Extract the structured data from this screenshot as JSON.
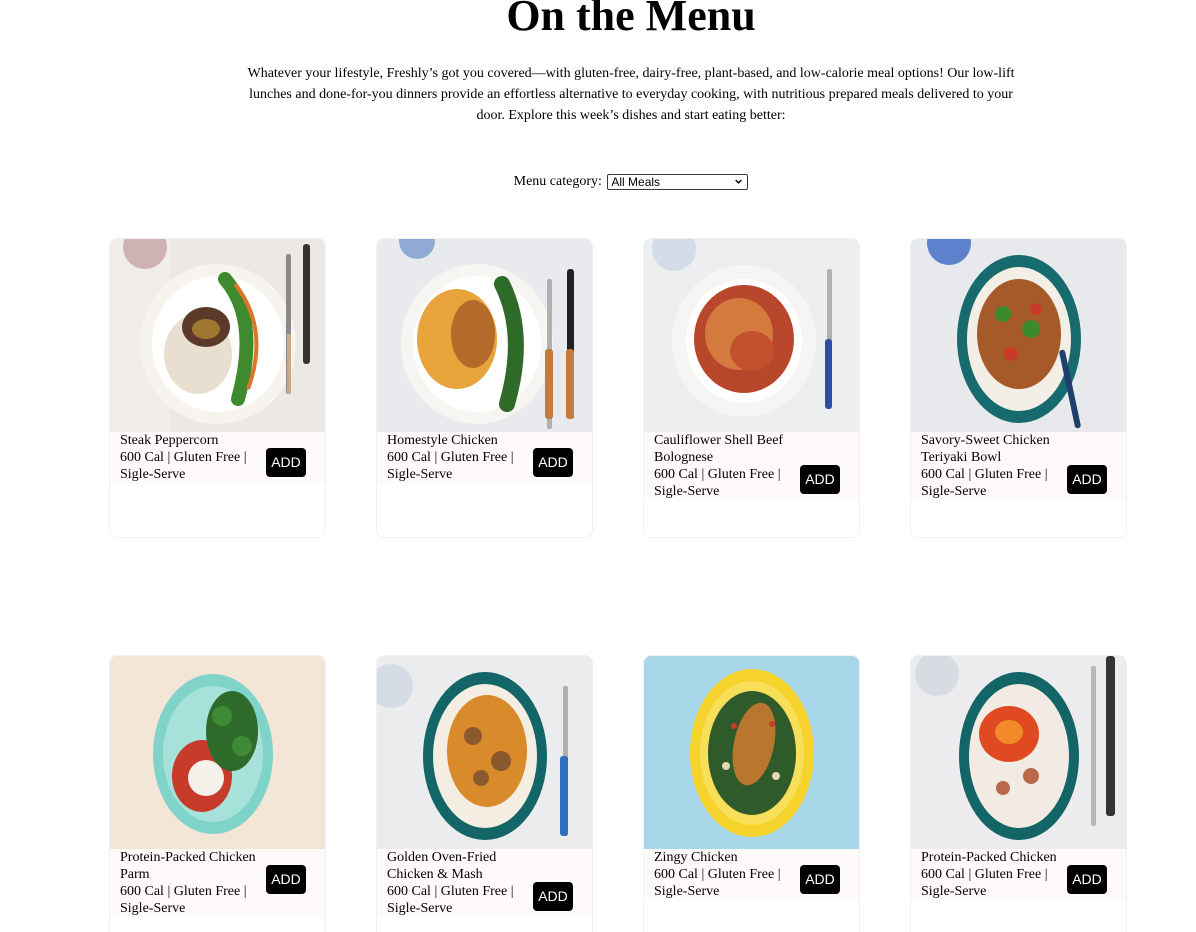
{
  "page": {
    "title": "On the Menu",
    "intro": "Whatever your lifestyle, Freshly’s got you covered—with gluten-free, dairy-free, plant-based, and low-calorie meal options! Our low-lift lunches and done-for-you dinners provide an effortless alternative to everyday cooking, with nutritious prepared meals delivered to your door. Explore this week’s dishes and start eating better:"
  },
  "filter": {
    "label": "Menu category:",
    "selected": "All Meals"
  },
  "meals": [
    {
      "name": "Steak Peppercorn",
      "details": "600 Cal | Gluten Free | Sigle-Serve",
      "add_label": "ADD"
    },
    {
      "name": "Homestyle Chicken",
      "details": "600 Cal | Gluten Free | Sigle-Serve",
      "add_label": "ADD"
    },
    {
      "name": "Cauliflower Shell Beef Bolognese",
      "details": "600 Cal | Gluten Free | Sigle-Serve",
      "add_label": "ADD"
    },
    {
      "name": "Savory-Sweet Chicken Teriyaki Bowl",
      "details": "600 Cal | Gluten Free | Sigle-Serve",
      "add_label": "ADD"
    },
    {
      "name": "Protein-Packed Chicken Parm",
      "details": "600 Cal | Gluten Free | Sigle-Serve",
      "add_label": "ADD"
    },
    {
      "name": "Golden Oven-Fried Chicken & Mash",
      "details": "600 Cal | Gluten Free | Sigle-Serve",
      "add_label": "ADD"
    },
    {
      "name": "Zingy Chicken",
      "details": "600 Cal | Gluten Free | Sigle-Serve",
      "add_label": "ADD"
    },
    {
      "name": "Protein-Packed Chicken",
      "details": "600 Cal | Gluten Free | Sigle-Serve",
      "add_label": "ADD"
    }
  ]
}
